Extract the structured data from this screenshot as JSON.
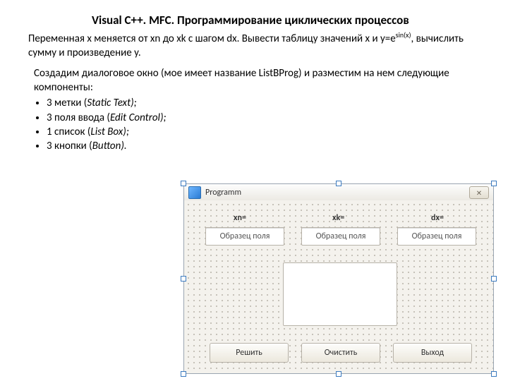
{
  "title": "Visual C++. MFC. Программирование циклических процессов",
  "para1": "Переменная x меняется от xn до xk с шагом dx. Вывести таблицу значений x и y=e",
  "para1_sup": "sin(x)",
  "para1_after": ", вычислить сумму и произведение y.",
  "para2": "Создадим диалоговое окно (мое имеет название ListBProg) и разместим на нем следующие компоненты:",
  "bullets": [
    {
      "t1": "3 метки (",
      "ti": "Static Text);"
    },
    {
      "t1": "3 поля ввода (",
      "ti": "Edit Control);"
    },
    {
      "t1": "1 список (",
      "ti": "List Box);"
    },
    {
      "t1": "3 кнопки (",
      "ti": "Button)."
    }
  ],
  "dialog": {
    "title": "Programm",
    "close": "✕",
    "labels": {
      "xn": "xn=",
      "xk": "xk=",
      "dx": "dx="
    },
    "placeholder": "Образец поля",
    "buttons": {
      "solve": "Решить",
      "clear": "Очистить",
      "exit": "Выход"
    }
  }
}
